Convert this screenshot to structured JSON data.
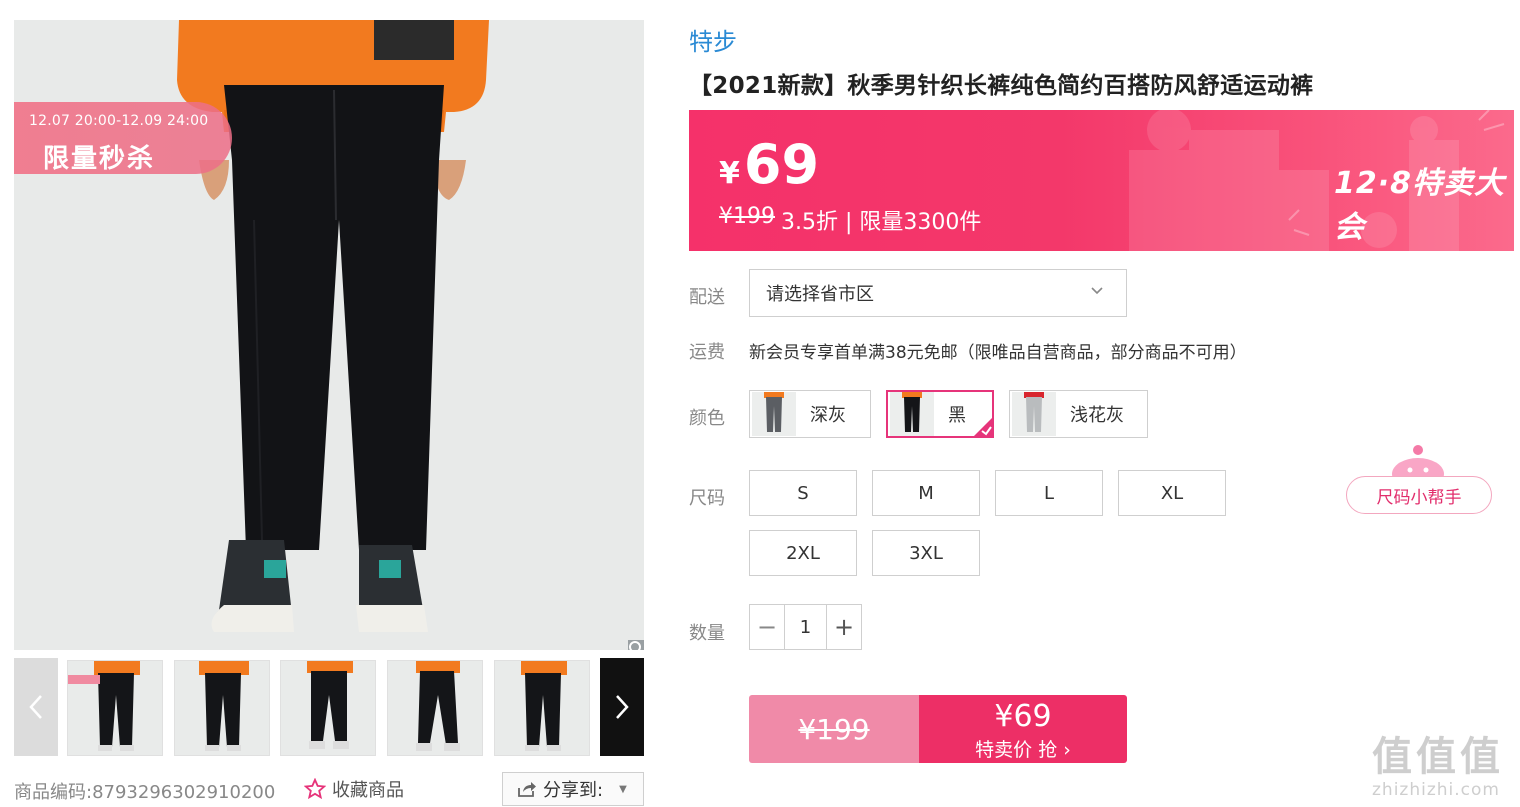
{
  "gallery": {
    "promo_time": "12.07 20:00-12.09 24:00",
    "promo_title": "限量秒杀",
    "thumbnail_count": 5
  },
  "meta": {
    "product_code_label": "商品编码:",
    "product_code": "8793296302910200",
    "favorite_label": "收藏商品",
    "share_label": "分享到:"
  },
  "product": {
    "brand": "特步",
    "title": "【2021新款】秋季男针织长裤纯色简约百搭防风舒适运动裤"
  },
  "price_banner": {
    "currency": "¥",
    "price": "69",
    "original_price": "¥199",
    "discount_info": "3.5折 | 限量3300件",
    "event_title": "12·8特卖大会"
  },
  "options": {
    "delivery_label": "配送",
    "region_placeholder": "请选择省市区",
    "shipping_label": "运费",
    "shipping_text": "新会员专享首单满38元免邮（限唯品自营商品，部分商品不可用）",
    "color_label": "颜色",
    "colors": [
      {
        "label": "深灰",
        "selected": false
      },
      {
        "label": "黑",
        "selected": true
      },
      {
        "label": "浅花灰",
        "selected": false
      }
    ],
    "size_label": "尺码",
    "sizes": [
      "S",
      "M",
      "L",
      "XL",
      "2XL",
      "3XL"
    ],
    "size_helper": "尺码小帮手",
    "quantity_label": "数量",
    "quantity": "1",
    "minus": "−",
    "plus": "+"
  },
  "buy": {
    "original_price": "¥199",
    "price": "¥69",
    "label": "特卖价 抢 ›"
  },
  "watermark": {
    "main": "值值值",
    "sub": "zhizhizhi.com"
  },
  "colors_theme": {
    "accent": "#ed2f66",
    "brand_link": "#2a8ad4"
  }
}
